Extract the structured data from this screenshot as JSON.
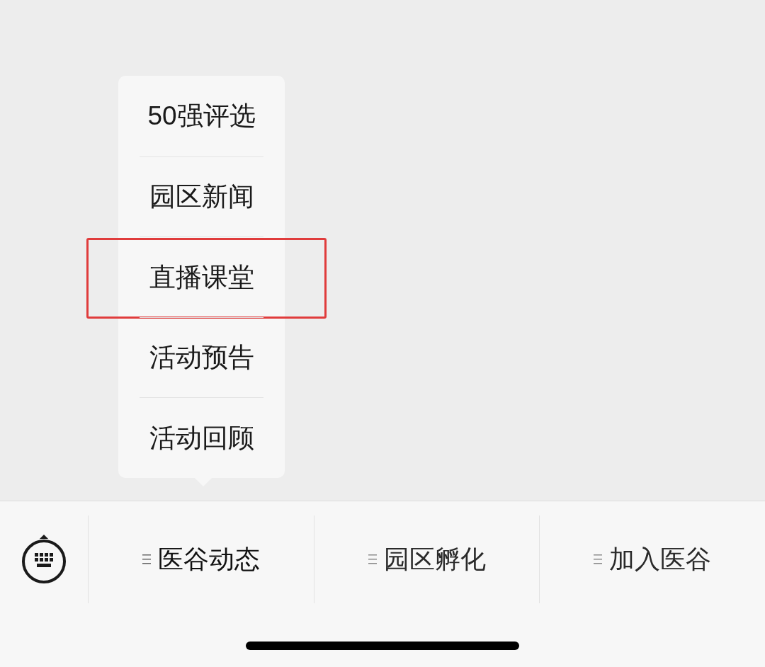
{
  "popup_menu": {
    "items": [
      {
        "label": "50强评选",
        "highlighted": false
      },
      {
        "label": "园区新闻",
        "highlighted": false
      },
      {
        "label": "直播课堂",
        "highlighted": true
      },
      {
        "label": "活动预告",
        "highlighted": false
      },
      {
        "label": "活动回顾",
        "highlighted": false
      }
    ]
  },
  "menu_bar": {
    "tabs": [
      {
        "label": "医谷动态",
        "selected": true
      },
      {
        "label": "园区孵化",
        "selected": false
      },
      {
        "label": "加入医谷",
        "selected": false
      }
    ]
  }
}
